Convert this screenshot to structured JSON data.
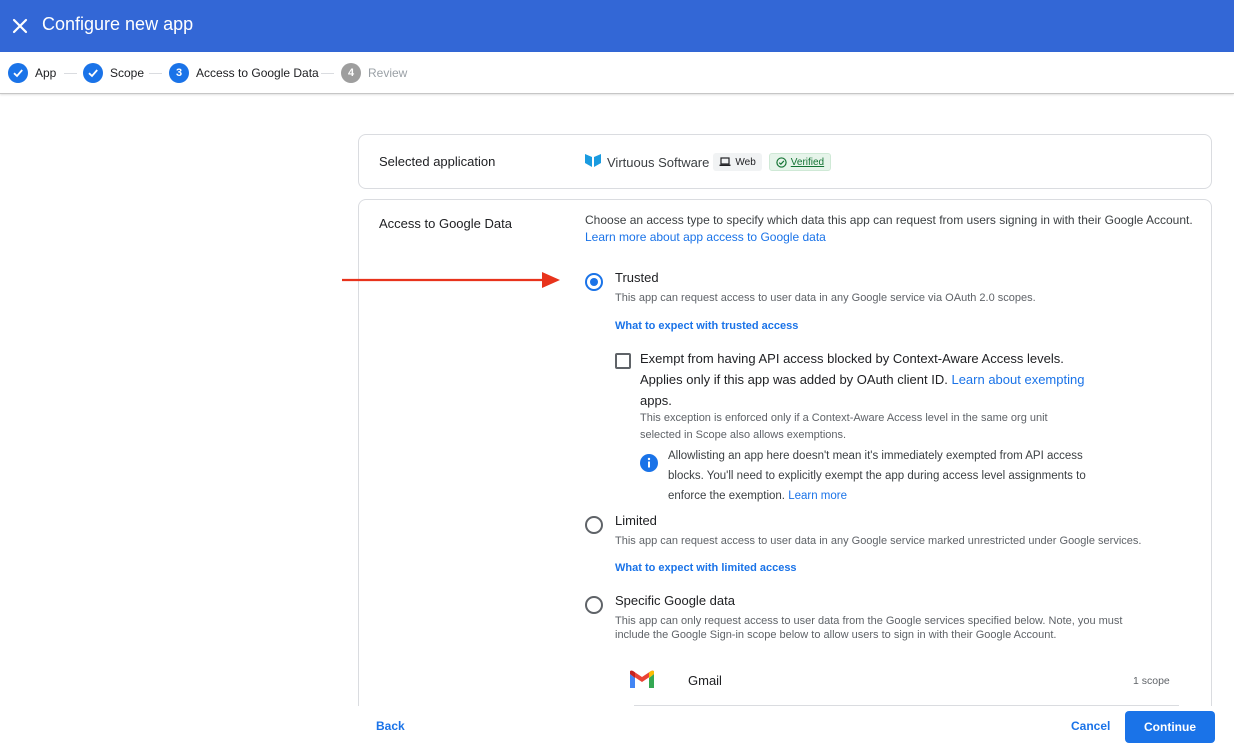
{
  "header": {
    "title": "Configure new app",
    "close_icon": "close-icon",
    "color": "#3367d6"
  },
  "stepper": {
    "steps": [
      {
        "label": "App",
        "state": "done",
        "icon": "check-icon"
      },
      {
        "label": "Scope",
        "state": "done",
        "icon": "check-icon"
      },
      {
        "label": "Access to Google Data",
        "state": "current",
        "number": "3"
      },
      {
        "label": "Review",
        "state": "upcoming",
        "number": "4"
      }
    ]
  },
  "selected_app": {
    "label": "Selected application",
    "app_name": "Virtuous Software",
    "app_icon": "virtuous-logo-icon",
    "type_chip": "Web",
    "type_icon": "laptop-icon",
    "verified_chip": "Verified",
    "verified_icon": "check-circle-icon"
  },
  "access": {
    "label": "Access to Google Data",
    "intro": "Choose an access type to specify which data this app can request from users signing in with their Google Account.",
    "intro_link": "Learn more about app access to Google data",
    "options": {
      "trusted": {
        "title": "Trusted",
        "desc": "This app can request access to user data in any Google service via OAuth 2.0 scopes.",
        "link": "What to expect with trusted access",
        "checked": true
      },
      "exempt": {
        "line1": "Exempt from having API access blocked by Context-Aware Access levels.",
        "line2": "Applies only if this app was added by OAuth client ID.",
        "link_a": "Learn about exempting",
        "link_b": "apps.",
        "note1": "This exception is enforced only if a Context-Aware Access level in the same org unit",
        "note2": "selected in Scope also allows exemptions.",
        "info1": "Allowlisting an app here doesn't mean it's immediately exempted from API access",
        "info2": "blocks. You'll need to explicitly exempt the app during access level assignments to",
        "info3": "enforce the exemption.",
        "info_link": "Learn more",
        "checked": false
      },
      "limited": {
        "title": "Limited",
        "desc": "This app can request access to user data in any Google service marked unrestricted under Google services.",
        "link": "What to expect with limited access",
        "checked": false
      },
      "specific": {
        "title": "Specific Google data",
        "desc1": "This app can only request access to user data from the Google services specified below. Note, you must",
        "desc2": "include the Google Sign-in scope below to allow users to sign in with their Google Account.",
        "checked": false
      }
    },
    "services": [
      {
        "name": "Gmail",
        "icon": "gmail-icon",
        "scopes": "1 scope"
      }
    ]
  },
  "footer": {
    "back": "Back",
    "cancel": "Cancel",
    "continue": "Continue"
  },
  "annotation": {
    "arrow_color": "#e8331c"
  }
}
